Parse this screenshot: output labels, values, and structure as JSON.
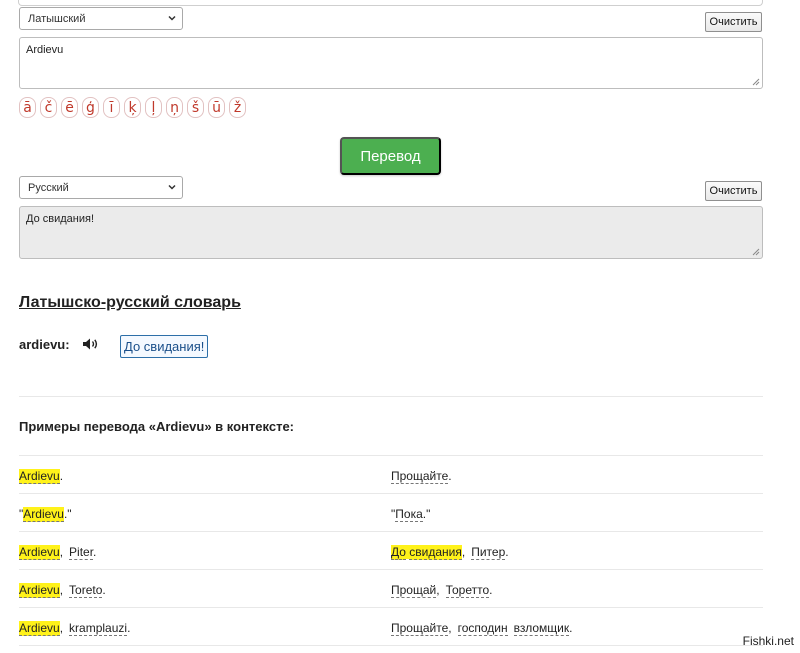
{
  "source": {
    "language": "Латышский",
    "clear_label": "Очистить",
    "text": "Ardievu"
  },
  "special_chars": [
    "ā",
    "č",
    "ē",
    "ģ",
    "ī",
    "ķ",
    "ļ",
    "ņ",
    "š",
    "ū",
    "ž"
  ],
  "translate_label": "Перевод",
  "target": {
    "language": "Русский",
    "clear_label": "Очистить",
    "text": "До свидания!"
  },
  "dictionary": {
    "title": "Латышско-русский словарь",
    "word": "ardievu:",
    "translation": "До свидания!"
  },
  "examples": {
    "title": "Примеры перевода «Ardievu» в контексте:"
  },
  "watermark": "Fishki.net",
  "colors": {
    "accent_green": "#4caf50",
    "highlight": "#fff21a",
    "char_red": "#c0392b",
    "link_blue": "#1a4f8a"
  }
}
